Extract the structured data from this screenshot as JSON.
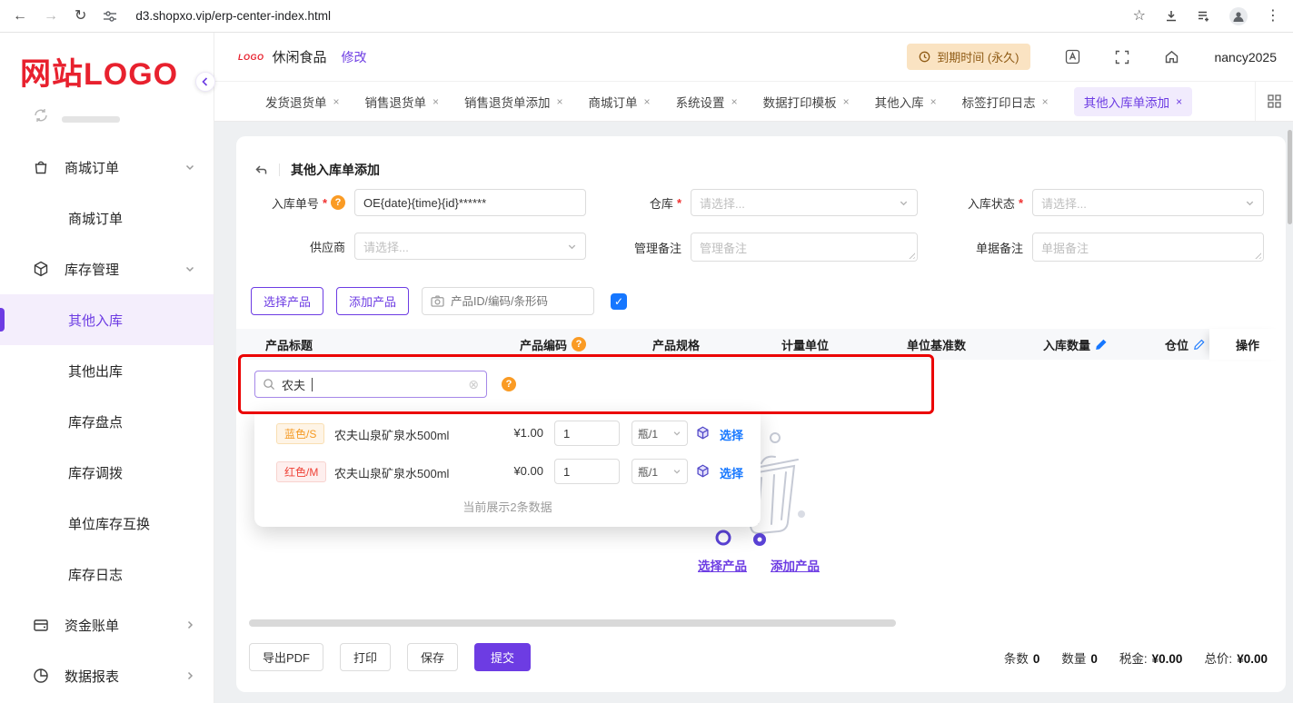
{
  "glyphs": {
    "back": "←",
    "forward": "→",
    "refresh": "↻",
    "star": "☆",
    "kebab": "⋮",
    "close": "×",
    "check": "✓",
    "clear": "⊗",
    "question": "?",
    "asterisk": "*"
  },
  "colors": {
    "accent": "#6d3ce3",
    "accent_bg": "#f1ebfd",
    "link": "#1677ff",
    "logo_red": "#e8212e",
    "badge_bg": "#fae3c2",
    "badge_text": "#8f5b15",
    "annotation": "#eb0000",
    "tag_orange": "#f59a23",
    "tag_orange_bg": "#fef4e6",
    "tag_orange_border": "#f9dfb2",
    "tag_red": "#ef4136",
    "tag_red_bg": "#feefee",
    "tag_red_border": "#f8d3cf"
  },
  "browser": {
    "url": "d3.shopxo.vip/erp-center-index.html"
  },
  "sidebar": {
    "logo_text": "网站LOGO",
    "groups": [
      {
        "label": "商城订单",
        "children": [
          {
            "label": "商城订单"
          }
        ]
      },
      {
        "label": "库存管理",
        "children": [
          {
            "label": "其他入库"
          },
          {
            "label": "其他出库"
          },
          {
            "label": "库存盘点"
          },
          {
            "label": "库存调拨"
          },
          {
            "label": "单位库存互换"
          },
          {
            "label": "库存日志"
          }
        ]
      },
      {
        "label": "资金账单"
      },
      {
        "label": "数据报表"
      }
    ]
  },
  "header": {
    "mini_logo": "LOGO",
    "store_name": "休闲食品",
    "edit_link": "修改",
    "expire_badge": "到期时间 (永久)",
    "username": "nancy2025"
  },
  "tabs": [
    {
      "label": "发货退货单"
    },
    {
      "label": "销售退货单"
    },
    {
      "label": "销售退货单添加"
    },
    {
      "label": "商城订单"
    },
    {
      "label": "系统设置"
    },
    {
      "label": "数据打印模板"
    },
    {
      "label": "其他入库"
    },
    {
      "label": "标签打印日志"
    },
    {
      "label": "其他入库单添加"
    }
  ],
  "page": {
    "title": "其他入库单添加",
    "form": {
      "order_no_label": "入库单号",
      "order_no_value": "OE{date}{time}{id}******",
      "warehouse_label": "仓库",
      "warehouse_placeholder": "请选择...",
      "status_label": "入库状态",
      "status_placeholder": "请选择...",
      "supplier_label": "供应商",
      "supplier_placeholder": "请选择...",
      "admin_note_label": "管理备注",
      "admin_note_placeholder": "管理备注",
      "doc_note_label": "单据备注",
      "doc_note_placeholder": "单据备注"
    },
    "toolbar": {
      "select_product": "选择产品",
      "add_product": "添加产品",
      "scan_placeholder": "产品ID/编码/条形码"
    },
    "table": {
      "headers": [
        "产品标题",
        "产品编码",
        "产品规格",
        "计量单位",
        "单位基准数",
        "入库数量",
        "仓位",
        "操作"
      ]
    },
    "search": {
      "query": "农夫",
      "results": [
        {
          "tag": "蓝色/S",
          "name": "农夫山泉矿泉水500ml",
          "price": "¥1.00",
          "qty": "1",
          "unit": "瓶/1",
          "action": "选择"
        },
        {
          "tag": "红色/M",
          "name": "农夫山泉矿泉水500ml",
          "price": "¥0.00",
          "qty": "1",
          "unit": "瓶/1",
          "action": "选择"
        }
      ],
      "footer": "当前展示2条数据"
    },
    "empty": {
      "select_product": "选择产品",
      "add_product": "添加产品"
    },
    "footer": {
      "buttons": [
        "导出PDF",
        "打印",
        "保存",
        "提交"
      ],
      "stats": [
        {
          "label": "条数",
          "value": "0"
        },
        {
          "label": "数量",
          "value": "0"
        },
        {
          "label": "税金:",
          "value": "¥0.00"
        },
        {
          "label": "总价:",
          "value": "¥0.00"
        }
      ]
    }
  }
}
